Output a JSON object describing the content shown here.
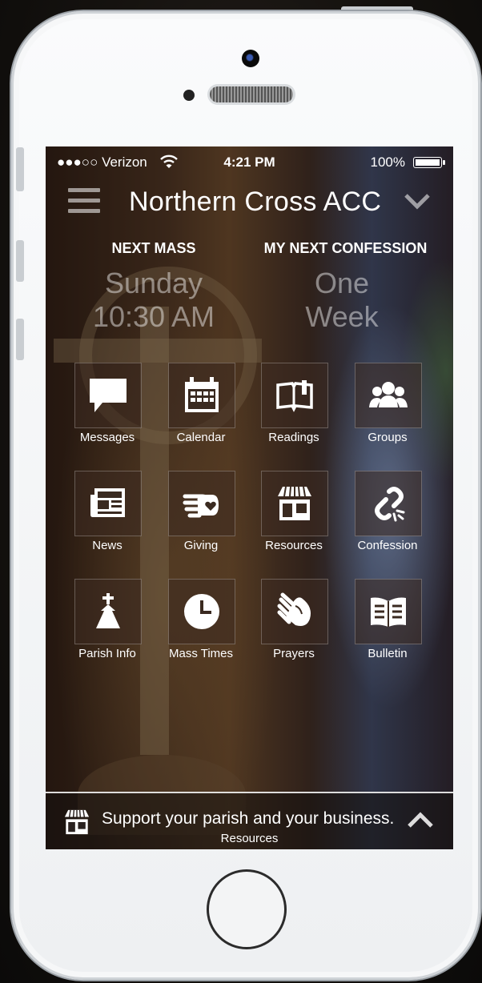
{
  "status": {
    "carrier": "●●●○○ Verizon",
    "time": "4:21 PM",
    "battery": "100%"
  },
  "header": {
    "title": "Northern Cross ACC"
  },
  "info": {
    "next_mass_label": "NEXT MASS",
    "next_mass_day": "Sunday",
    "next_mass_time": "10:30 AM",
    "confession_label": "MY NEXT CONFESSION",
    "confession_value_1": "One",
    "confession_value_2": "Week"
  },
  "tiles": [
    {
      "label": "Messages",
      "icon": "chat-bubble-icon"
    },
    {
      "label": "Calendar",
      "icon": "calendar-icon"
    },
    {
      "label": "Readings",
      "icon": "open-book-icon"
    },
    {
      "label": "Groups",
      "icon": "group-icon"
    },
    {
      "label": "News",
      "icon": "newspaper-icon"
    },
    {
      "label": "Giving",
      "icon": "giving-hand-icon"
    },
    {
      "label": "Resources",
      "icon": "storefront-icon"
    },
    {
      "label": "Confession",
      "icon": "broken-link-icon"
    },
    {
      "label": "Parish Info",
      "icon": "church-icon"
    },
    {
      "label": "Mass Times",
      "icon": "clock-icon"
    },
    {
      "label": "Prayers",
      "icon": "praying-hands-icon"
    },
    {
      "label": "Bulletin",
      "icon": "bulletin-book-icon"
    }
  ],
  "footer": {
    "text": "Support your parish and your business.",
    "sub": "Resources"
  }
}
